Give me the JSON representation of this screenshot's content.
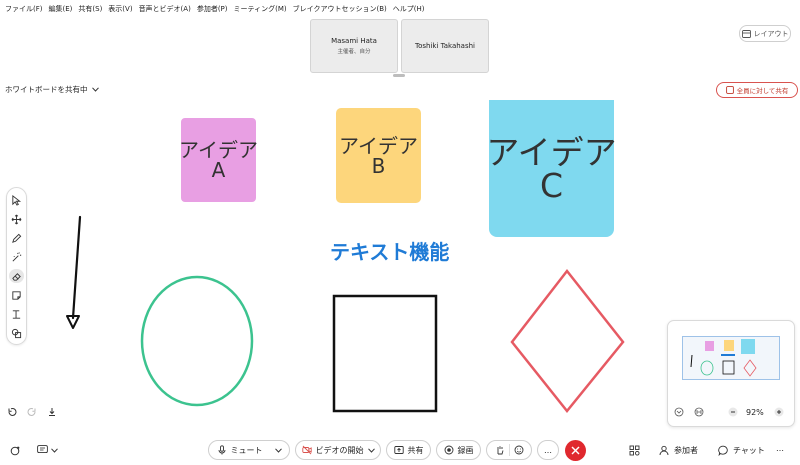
{
  "menu": [
    "ファイル(F)",
    "編集(E)",
    "共有(S)",
    "表示(V)",
    "音声とビデオ(A)",
    "参加者(P)",
    "ミーティング(M)",
    "ブレイクアウトセッション(B)",
    "ヘルプ(H)"
  ],
  "participants": [
    {
      "name": "Masami Hata",
      "role": "主催者、自分"
    },
    {
      "name": "Toshiki Takahashi",
      "role": ""
    }
  ],
  "layout_label": "レイアウト",
  "share_label": "ホワイトボードを共有中",
  "share_all_label": "全員に対して共有",
  "notes": [
    {
      "text": "アイデア\nA",
      "color": "#e89fe3"
    },
    {
      "text": "アイデア\nB",
      "color": "#fdd67c"
    },
    {
      "text": "アイデア\nC",
      "color": "#7fd9ef"
    }
  ],
  "heading": "テキスト機能",
  "shapes": {
    "ellipse_color": "#3cc38f",
    "square_color": "#111111",
    "diamond_color": "#e65a63"
  },
  "toolbar_tools": [
    "select-icon",
    "move-icon",
    "pen-icon",
    "magic-pen-icon",
    "eraser-icon",
    "sticky-note-icon",
    "text-icon",
    "shapes-icon"
  ],
  "minimap": {
    "zoom": "92%"
  },
  "bottom": {
    "mute": "ミュート",
    "video": "ビデオの開始",
    "share": "共有",
    "record": "録画",
    "more": "…",
    "participants": "参加者",
    "chat": "チャット",
    "overflow": "…"
  },
  "colors": {
    "accent": "#1f7bd6",
    "danger": "#e0282e"
  }
}
